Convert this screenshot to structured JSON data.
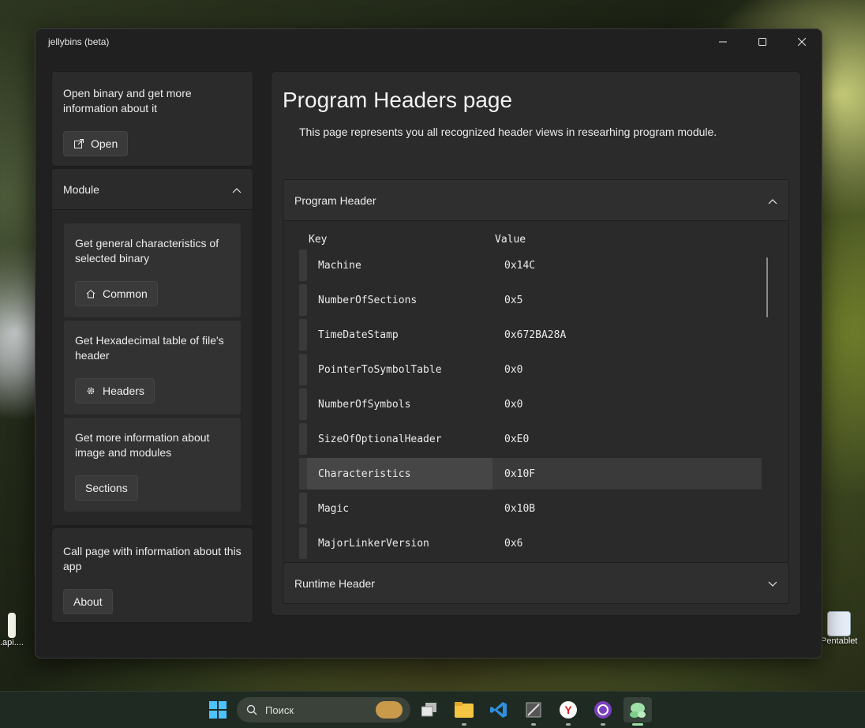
{
  "window": {
    "title": "jellybins (beta)"
  },
  "sidebar": {
    "open_card": {
      "text": "Open binary and get more information about it",
      "button": "Open"
    },
    "module": {
      "label": "Module",
      "items": [
        {
          "text": "Get general characteristics of selected binary",
          "button": "Common",
          "icon": "home-icon"
        },
        {
          "text": "Get Hexadecimal table of file's header",
          "button": "Headers",
          "icon": "gear-icon"
        },
        {
          "text": "Get more information about image and modules",
          "button": "Sections"
        }
      ]
    },
    "about_card": {
      "text": "Call page with information about this app",
      "button": "About"
    }
  },
  "page": {
    "title": "Program Headers page",
    "description": "This page represents you all recognized header views in researhing program module."
  },
  "program_header": {
    "label": "Program Header",
    "columns": {
      "key": "Key",
      "value": "Value"
    },
    "rows": [
      {
        "key": "Machine",
        "value": "0x14C"
      },
      {
        "key": "NumberOfSections",
        "value": "0x5"
      },
      {
        "key": "TimeDateStamp",
        "value": "0x672BA28A"
      },
      {
        "key": "PointerToSymbolTable",
        "value": "0x0"
      },
      {
        "key": "NumberOfSymbols",
        "value": "0x0"
      },
      {
        "key": "SizeOfOptionalHeader",
        "value": "0xE0"
      },
      {
        "key": "Characteristics",
        "value": "0x10F"
      },
      {
        "key": "Magic",
        "value": "0x10B"
      },
      {
        "key": "MajorLinkerVersion",
        "value": "0x6"
      }
    ],
    "selected_row": "Characteristics"
  },
  "runtime_header": {
    "label": "Runtime Header"
  },
  "desktop": {
    "icons": [
      {
        "label": ".api...."
      },
      {
        "label": "Pentablet"
      }
    ]
  },
  "taskbar": {
    "search_placeholder": "Поиск",
    "apps": [
      "start-icon",
      "task-view-icon",
      "file-explorer-icon",
      "vscode-icon",
      "app-icon",
      "yandex-browser-icon",
      "github-desktop-icon",
      "jellybins-icon"
    ]
  },
  "colors": {
    "window_bg": "#202020",
    "card_bg": "#2b2b2b",
    "button_bg": "#3a3a3a",
    "selected_row": "#464646"
  }
}
